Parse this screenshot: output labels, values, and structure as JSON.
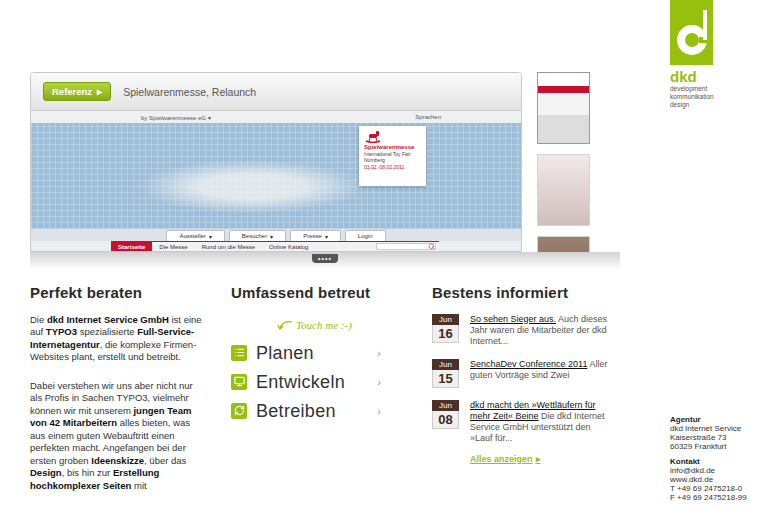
{
  "logo": {
    "wordmark": "dkd",
    "tagline": [
      "development",
      "kommunikation",
      "design"
    ]
  },
  "showcase": {
    "badge": "Referenz",
    "badge_icon": "▸",
    "title": "Spielwarenmesse, Relaunch",
    "site": {
      "owner": "by Spielwarenmesse eG",
      "owner_icon": "▾",
      "languages": "Sprachen",
      "card": {
        "name": "Spielwarenmesse",
        "subtitle": "International Toy Fair Nürnberg",
        "dates": "03.02.-08.02.2011"
      },
      "tab_caret": "▾",
      "tabs": [
        {
          "label": "Aussteller",
          "menu": true
        },
        {
          "label": "Besucher",
          "menu": true
        },
        {
          "label": "Presse",
          "menu": true
        },
        {
          "label": "Login",
          "menu": false
        }
      ],
      "nav": [
        {
          "label": "Startseite",
          "selected": true
        },
        {
          "label": "Die Messe",
          "selected": false
        },
        {
          "label": "Rund um die Messe",
          "selected": false
        },
        {
          "label": "Online Katalog",
          "selected": false
        }
      ]
    },
    "thumbnails": [
      {
        "selected": true
      },
      {
        "selected": false
      },
      {
        "selected": false
      }
    ],
    "pager": "••••"
  },
  "consult": {
    "title": "Perfekt beraten",
    "paragraphs": [
      [
        {
          "text": "Die ",
          "bold": false
        },
        {
          "text": "dkd Internet Service GmbH",
          "bold": true
        },
        {
          "text": " ist eine auf ",
          "bold": false
        },
        {
          "text": "TYPO3",
          "bold": true
        },
        {
          "text": " spezialisierte ",
          "bold": false
        },
        {
          "text": "Full-Service-Internetagentur",
          "bold": true
        },
        {
          "text": ", die komplexe Firmen-Websites plant, erstellt und betreibt.",
          "bold": false
        }
      ],
      [
        {
          "text": "Dabei verstehen wir uns aber nicht nur als Profis in Sachen TYPO3, vielmehr können wir mit unserem ",
          "bold": false
        },
        {
          "text": "jungen Team von 42 Mitarbeitern",
          "bold": true
        },
        {
          "text": " alles bieten, was aus einem guten Webauftritt einen perfekten macht. Angefangen bei der ersten groben ",
          "bold": false
        },
        {
          "text": "Ideenskizze",
          "bold": true
        },
        {
          "text": ", über das ",
          "bold": false
        },
        {
          "text": "Design",
          "bold": true
        },
        {
          "text": ", bis hin zur ",
          "bold": false
        },
        {
          "text": "Erstellung",
          "bold": true
        },
        {
          "text": " ",
          "bold": false
        },
        {
          "text": "hochkomplexer Seiten",
          "bold": true
        },
        {
          "text": " mit",
          "bold": false
        }
      ]
    ]
  },
  "services": {
    "title": "Umfassend betreut",
    "hint": "Touch me :-)",
    "items": [
      {
        "label": "Planen",
        "arrow": "›"
      },
      {
        "label": "Entwickeln",
        "arrow": "›"
      },
      {
        "label": "Betreiben",
        "arrow": "›"
      }
    ]
  },
  "news": {
    "title": "Bestens informiert",
    "items": [
      {
        "month": "Jun",
        "day": "16",
        "title": "So sehen Sieger aus.",
        "teaser": "Auch dieses Jahr waren die Mitarbeiter der dkd Internet..."
      },
      {
        "month": "Jun",
        "day": "15",
        "title": "SenchaDev Conference 2011",
        "teaser": "Aller guten Vorträge sind Zwei"
      },
      {
        "month": "Jun",
        "day": "08",
        "title": "dkd macht den »Wettläufern für mehr Zeit« Beine",
        "teaser": "Die dkd Internet Service GmbH unterstützt den »Lauf für..."
      }
    ],
    "more": "Alles anzeigen",
    "more_icon": "▸"
  },
  "contact": {
    "groups": [
      {
        "title": "Agentur",
        "lines": [
          "dkd Internet Service",
          "Kaiserstraße 73",
          "60329 Frankfurt"
        ]
      },
      {
        "title": "Kontakt",
        "lines": [
          "info@dkd.de",
          "www.dkd.de",
          "T +49 69 2475218-0",
          "F +49 69 2475218-99"
        ]
      }
    ]
  }
}
